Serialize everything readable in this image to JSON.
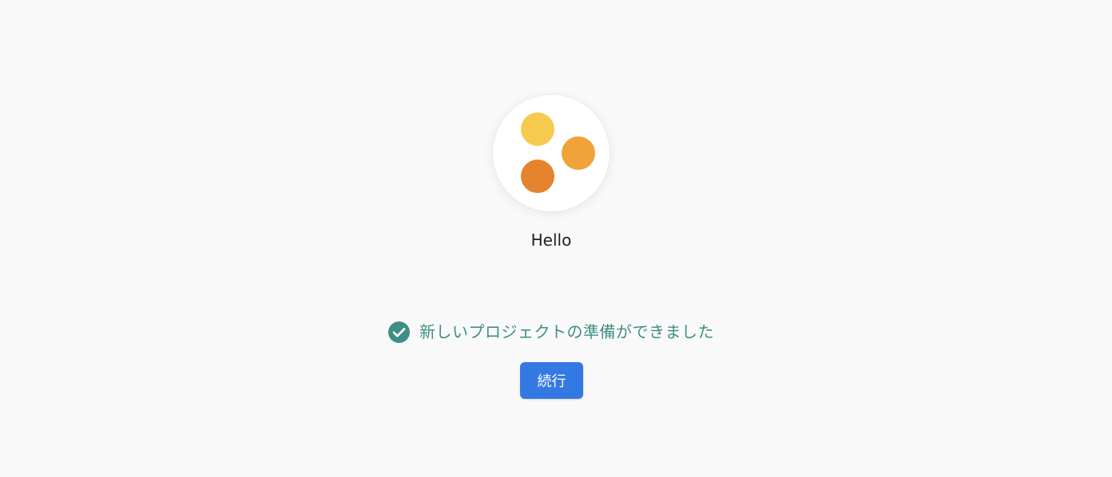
{
  "project": {
    "name": "Hello",
    "logo": {
      "icon": "three-dots-logo",
      "colors": [
        "#f6ca4e",
        "#f0a33a",
        "#e6832f"
      ]
    }
  },
  "status": {
    "icon": "check-circle-icon",
    "color": "#3e8e86",
    "message": "新しいプロジェクトの準備ができました"
  },
  "actions": {
    "continue_label": "続行",
    "continue_color": "#3478e4"
  }
}
